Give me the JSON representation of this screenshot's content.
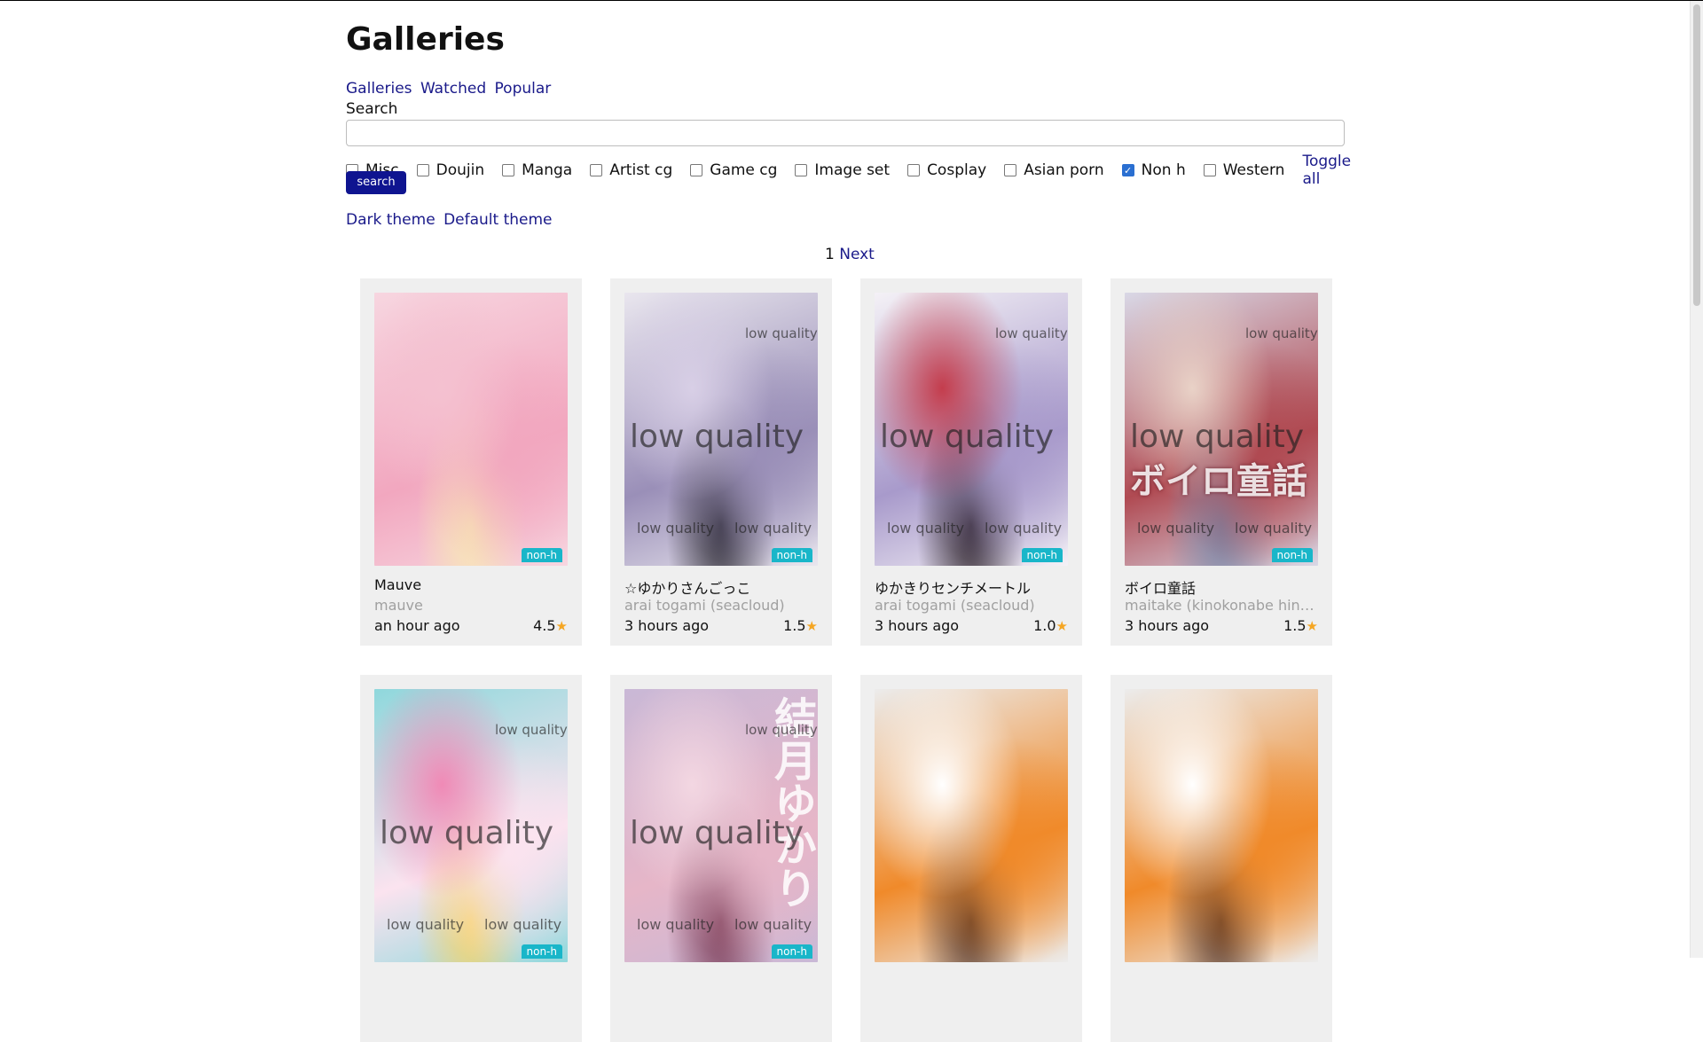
{
  "page": {
    "title": "Galleries"
  },
  "nav": {
    "galleries": "Galleries",
    "watched": "Watched",
    "popular": "Popular"
  },
  "search": {
    "label": "Search",
    "value": "",
    "button": "search"
  },
  "filters": [
    {
      "label": "Misc",
      "checked": false
    },
    {
      "label": "Doujin",
      "checked": false
    },
    {
      "label": "Manga",
      "checked": false
    },
    {
      "label": "Artist cg",
      "checked": false
    },
    {
      "label": "Game cg",
      "checked": false
    },
    {
      "label": "Image set",
      "checked": false
    },
    {
      "label": "Cosplay",
      "checked": false
    },
    {
      "label": "Asian porn",
      "checked": false
    },
    {
      "label": "Non h",
      "checked": true
    },
    {
      "label": "Western",
      "checked": false
    }
  ],
  "toggle_all": "Toggle all",
  "themes": {
    "dark": "Dark theme",
    "default": "Default theme"
  },
  "pager": {
    "current": "1",
    "next": "Next"
  },
  "colors": {
    "link": "#1a1a8a",
    "button": "#0f1490",
    "badge": "#19b6c9",
    "star": "#f5a623",
    "card_bg": "#efefef"
  },
  "galleries": [
    {
      "title": "Mauve",
      "artist": "mauve",
      "time": "an hour ago",
      "rating": "4.5",
      "badge": "non-h",
      "cover_colors": [
        "#f7d6e0",
        "#f2a7bf",
        "#f8e8b4",
        "#f4c1d0"
      ],
      "watermark": false,
      "big_text": ""
    },
    {
      "title": "☆ゆかりさんごっこ",
      "artist": "arai togami (seacloud)",
      "time": "3 hours ago",
      "rating": "1.5",
      "badge": "non-h",
      "cover_colors": [
        "#e9e6ee",
        "#9a8fb8",
        "#2d2a35",
        "#d8cfe6"
      ],
      "watermark": true,
      "big_text": ""
    },
    {
      "title": "ゆかきりセンチメートル",
      "artist": "arai togami (seacloud)",
      "time": "3 hours ago",
      "rating": "1.0",
      "badge": "non-h",
      "cover_colors": [
        "#f4f1f6",
        "#a89acb",
        "#2a1f28",
        "#c43d4d"
      ],
      "watermark": true,
      "big_text": ""
    },
    {
      "title": "ボイロ童話",
      "artist": "maitake (kinokonabe hinan...",
      "time": "3 hours ago",
      "rating": "1.5",
      "badge": "non-h",
      "cover_colors": [
        "#d9d8e6",
        "#b04a52",
        "#7b86a6",
        "#e9d2c7"
      ],
      "watermark": true,
      "big_text": "ボイロ童話"
    },
    {
      "title": "",
      "artist": "",
      "time": "",
      "rating": "",
      "badge": "non-h",
      "cover_colors": [
        "#8fd8dc",
        "#fbe3ef",
        "#f6d36b",
        "#f08ab6"
      ],
      "watermark": true,
      "big_text": ""
    },
    {
      "title": "",
      "artist": "",
      "time": "",
      "rating": "",
      "badge": "non-h",
      "cover_colors": [
        "#c9b8d6",
        "#e6b6c8",
        "#7a3a55",
        "#f3d7e2"
      ],
      "watermark": true,
      "big_text": "結月ゆかり"
    },
    {
      "title": "",
      "artist": "",
      "time": "",
      "rating": "",
      "badge": "",
      "cover_colors": [
        "#ececec",
        "#f08a2a",
        "#5b3a2a",
        "#ffffff"
      ],
      "watermark": false,
      "big_text": ""
    },
    {
      "title": "",
      "artist": "",
      "time": "",
      "rating": "",
      "badge": "",
      "cover_colors": [
        "#ececec",
        "#f08a2a",
        "#5b3a2a",
        "#ffffff"
      ],
      "watermark": false,
      "big_text": ""
    }
  ],
  "watermark_text": "low quality"
}
